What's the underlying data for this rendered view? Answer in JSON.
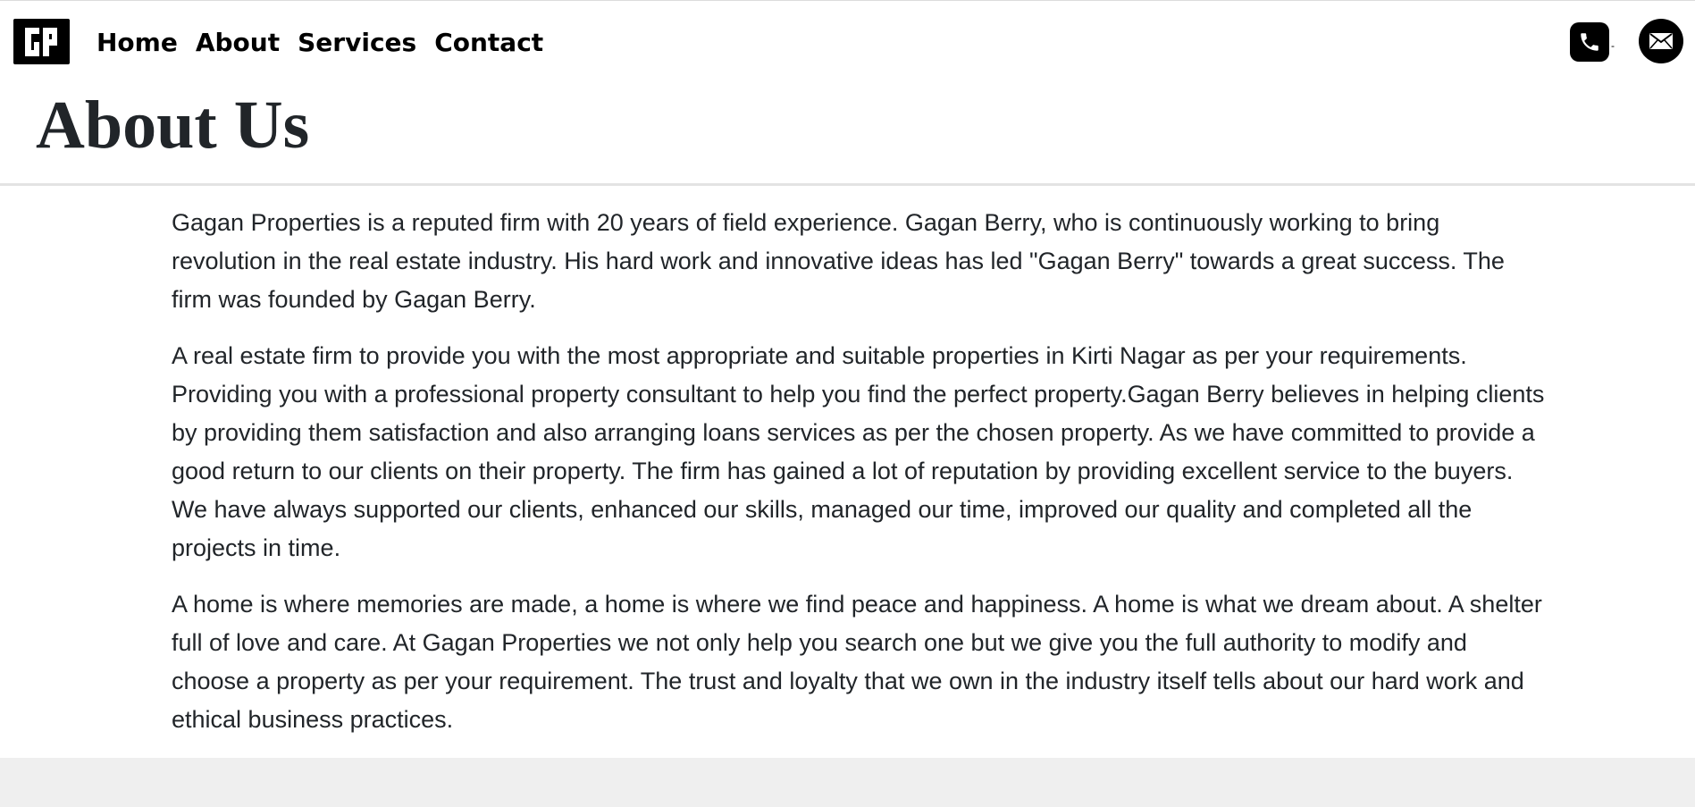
{
  "brand": {
    "logo_text": "GP"
  },
  "nav": {
    "items": [
      {
        "label": "Home"
      },
      {
        "label": "About"
      },
      {
        "label": "Services"
      },
      {
        "label": "Contact"
      }
    ]
  },
  "contact": {
    "phone_icon": "phone-icon",
    "phone_suffix": "-",
    "mail_icon": "mail-icon"
  },
  "page": {
    "title": "About Us",
    "paragraphs": [
      "Gagan Properties is a reputed firm with 20 years of field experience. Gagan Berry, who is continuously working to bring revolution in the real estate industry. His hard work and innovative ideas has led \"Gagan Berry\" towards a great success. The firm was founded by Gagan Berry.",
      "A real estate firm to provide you with the most appropriate and suitable properties in Kirti Nagar as per your requirements. Providing you with a professional property consultant to help you find the perfect property.Gagan Berry believes in helping clients by providing them satisfaction and also arranging loans services as per the chosen property. As we have committed to provide a good return to our clients on their property. The firm has gained a lot of reputation by providing excellent service to the buyers. We have always supported our clients, enhanced our skills, managed our time, improved our quality and completed all the projects in time.",
      "A home is where memories are made, a home is where we find peace and happiness. A home is what we dream about. A shelter full of love and care. At Gagan Properties we not only help you search one but we give you the full authority to modify and choose a property as per your requirement. The trust and loyalty that we own in the industry itself tells about our hard work and ethical business practices."
    ]
  },
  "colors": {
    "text": "#212529",
    "accent": "#000000",
    "footer": "#efefef"
  }
}
